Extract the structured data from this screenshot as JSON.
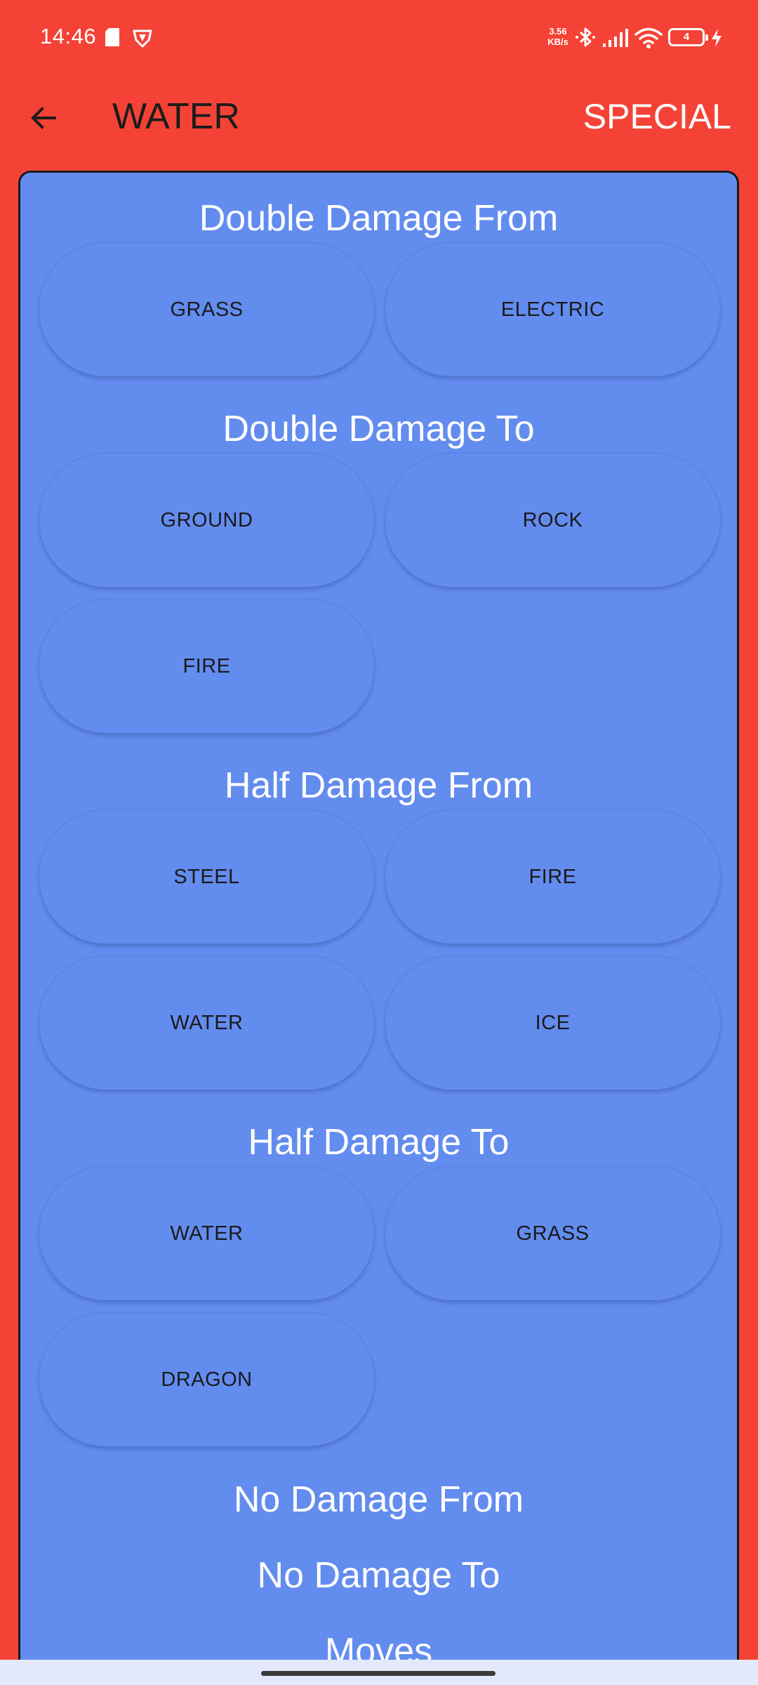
{
  "status_bar": {
    "time": "14:46",
    "network_speed": "3.56",
    "network_speed_unit": "KB/s",
    "battery_level": "4",
    "icons": [
      "sd-card-icon",
      "vpn-shield-icon",
      "bluetooth-icon",
      "cell-signal-icon",
      "wifi-icon",
      "battery-icon",
      "charging-icon"
    ]
  },
  "app_bar": {
    "back_icon": "arrow-left-icon",
    "title": "WATER",
    "action_label": "SPECIAL"
  },
  "colors": {
    "background": "#f44336",
    "card": "#638cef",
    "section_title": "#ffffff",
    "chip_text": "#1a1a1a"
  },
  "sections": {
    "double_damage_from": {
      "title": "Double Damage From",
      "types": [
        "GRASS",
        "ELECTRIC"
      ]
    },
    "double_damage_to": {
      "title": "Double Damage To",
      "types": [
        "GROUND",
        "ROCK",
        "FIRE"
      ]
    },
    "half_damage_from": {
      "title": "Half Damage From",
      "types": [
        "STEEL",
        "FIRE",
        "WATER",
        "ICE"
      ]
    },
    "half_damage_to": {
      "title": "Half Damage To",
      "types": [
        "WATER",
        "GRASS",
        "DRAGON"
      ]
    },
    "no_damage_from": {
      "title": "No Damage From"
    },
    "no_damage_to": {
      "title": "No Damage To"
    },
    "moves": {
      "title": "Moves"
    }
  }
}
